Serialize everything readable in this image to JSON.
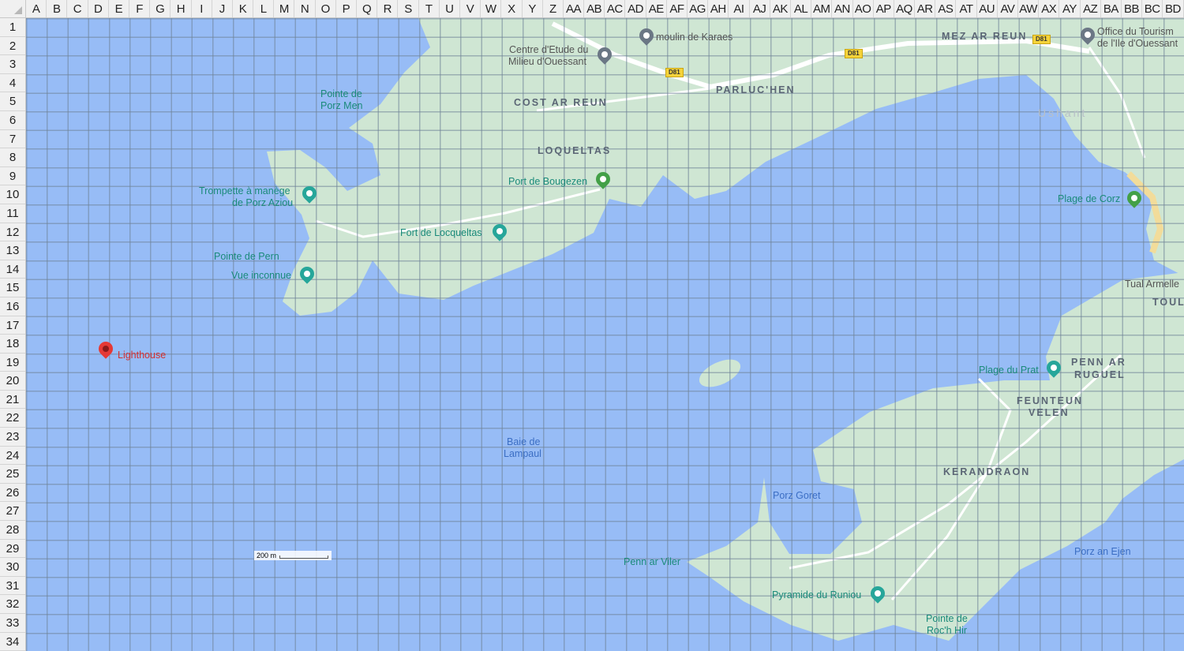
{
  "columns": [
    "A",
    "B",
    "C",
    "D",
    "E",
    "F",
    "G",
    "H",
    "I",
    "J",
    "K",
    "L",
    "M",
    "N",
    "O",
    "P",
    "Q",
    "R",
    "S",
    "T",
    "U",
    "V",
    "W",
    "X",
    "Y",
    "Z",
    "AA",
    "AB",
    "AC",
    "AD",
    "AE",
    "AF",
    "AG",
    "AH",
    "AI",
    "AJ",
    "AK",
    "AL",
    "AM",
    "AN",
    "AO",
    "AP",
    "AQ",
    "AR",
    "AS",
    "AT",
    "AU",
    "AV",
    "AW",
    "AX",
    "AY",
    "AZ",
    "BA",
    "BB",
    "BC",
    "BD"
  ],
  "rows": [
    "1",
    "2",
    "3",
    "4",
    "5",
    "6",
    "7",
    "8",
    "9",
    "10",
    "11",
    "12",
    "13",
    "14",
    "15",
    "16",
    "17",
    "18",
    "19",
    "20",
    "21",
    "22",
    "23",
    "24",
    "25",
    "26",
    "27",
    "28",
    "29",
    "30",
    "31",
    "32",
    "33",
    "34"
  ],
  "colors": {
    "water": "#97bcf6",
    "land": "#cfe6d3",
    "marker": "#e53935",
    "poi": "#1a8a7a"
  },
  "map": {
    "marker_label": "Lighthouse",
    "places": {
      "moulin": "moulin de Karaes",
      "centre1": "Centre d'Etude du",
      "centre2": "Milieu d'Ouessant",
      "mez": "MEZ AR REUN",
      "office1": "Office du Tourism",
      "office2": "de l'Ile d'Ouessant",
      "parluc": "PARLUC'HEN",
      "cost": "COST AR REUN",
      "loqueltas": "LOQUELTAS",
      "ushant": "Ushant",
      "porzmen1": "Pointe de",
      "porzmen2": "Porz Men",
      "trompette1": "Trompette à manège",
      "trompette2": "de Porz Aziou",
      "bougezen": "Port de Bougezen",
      "fort": "Fort de Locqueltas",
      "pern": "Pointe de Pern",
      "vue": "Vue inconnue",
      "corz": "Plage de Corz",
      "tual": "Tual Armelle",
      "toul": "TOUL",
      "prat": "Plage du Prat",
      "penn1": "PENN AR",
      "penn2": "RUGUEL",
      "feunteun1": "FEUNTEUN",
      "feunteun2": "VELEN",
      "baie1": "Baie de",
      "baie2": "Lampaul",
      "kerandraon": "KERANDRAON",
      "goret": "Porz Goret",
      "viler": "Penn ar Viler",
      "ejen": "Porz an Ejen",
      "pyramide": "Pyramide du Runiou",
      "roch1": "Pointe de",
      "roch2": "Roc'h Hir"
    },
    "road_shield": "D81",
    "scale": "200 m"
  }
}
